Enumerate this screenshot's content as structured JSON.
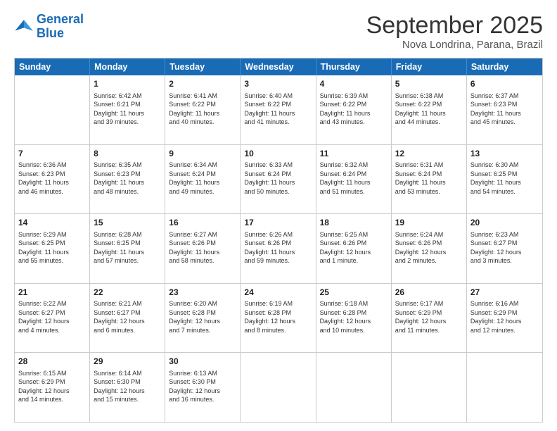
{
  "logo": {
    "line1": "General",
    "line2": "Blue"
  },
  "title": "September 2025",
  "subtitle": "Nova Londrina, Parana, Brazil",
  "days": [
    "Sunday",
    "Monday",
    "Tuesday",
    "Wednesday",
    "Thursday",
    "Friday",
    "Saturday"
  ],
  "weeks": [
    [
      {
        "day": "",
        "info": ""
      },
      {
        "day": "1",
        "info": "Sunrise: 6:42 AM\nSunset: 6:21 PM\nDaylight: 11 hours\nand 39 minutes."
      },
      {
        "day": "2",
        "info": "Sunrise: 6:41 AM\nSunset: 6:22 PM\nDaylight: 11 hours\nand 40 minutes."
      },
      {
        "day": "3",
        "info": "Sunrise: 6:40 AM\nSunset: 6:22 PM\nDaylight: 11 hours\nand 41 minutes."
      },
      {
        "day": "4",
        "info": "Sunrise: 6:39 AM\nSunset: 6:22 PM\nDaylight: 11 hours\nand 43 minutes."
      },
      {
        "day": "5",
        "info": "Sunrise: 6:38 AM\nSunset: 6:22 PM\nDaylight: 11 hours\nand 44 minutes."
      },
      {
        "day": "6",
        "info": "Sunrise: 6:37 AM\nSunset: 6:23 PM\nDaylight: 11 hours\nand 45 minutes."
      }
    ],
    [
      {
        "day": "7",
        "info": "Sunrise: 6:36 AM\nSunset: 6:23 PM\nDaylight: 11 hours\nand 46 minutes."
      },
      {
        "day": "8",
        "info": "Sunrise: 6:35 AM\nSunset: 6:23 PM\nDaylight: 11 hours\nand 48 minutes."
      },
      {
        "day": "9",
        "info": "Sunrise: 6:34 AM\nSunset: 6:24 PM\nDaylight: 11 hours\nand 49 minutes."
      },
      {
        "day": "10",
        "info": "Sunrise: 6:33 AM\nSunset: 6:24 PM\nDaylight: 11 hours\nand 50 minutes."
      },
      {
        "day": "11",
        "info": "Sunrise: 6:32 AM\nSunset: 6:24 PM\nDaylight: 11 hours\nand 51 minutes."
      },
      {
        "day": "12",
        "info": "Sunrise: 6:31 AM\nSunset: 6:24 PM\nDaylight: 11 hours\nand 53 minutes."
      },
      {
        "day": "13",
        "info": "Sunrise: 6:30 AM\nSunset: 6:25 PM\nDaylight: 11 hours\nand 54 minutes."
      }
    ],
    [
      {
        "day": "14",
        "info": "Sunrise: 6:29 AM\nSunset: 6:25 PM\nDaylight: 11 hours\nand 55 minutes."
      },
      {
        "day": "15",
        "info": "Sunrise: 6:28 AM\nSunset: 6:25 PM\nDaylight: 11 hours\nand 57 minutes."
      },
      {
        "day": "16",
        "info": "Sunrise: 6:27 AM\nSunset: 6:26 PM\nDaylight: 11 hours\nand 58 minutes."
      },
      {
        "day": "17",
        "info": "Sunrise: 6:26 AM\nSunset: 6:26 PM\nDaylight: 11 hours\nand 59 minutes."
      },
      {
        "day": "18",
        "info": "Sunrise: 6:25 AM\nSunset: 6:26 PM\nDaylight: 12 hours\nand 1 minute."
      },
      {
        "day": "19",
        "info": "Sunrise: 6:24 AM\nSunset: 6:26 PM\nDaylight: 12 hours\nand 2 minutes."
      },
      {
        "day": "20",
        "info": "Sunrise: 6:23 AM\nSunset: 6:27 PM\nDaylight: 12 hours\nand 3 minutes."
      }
    ],
    [
      {
        "day": "21",
        "info": "Sunrise: 6:22 AM\nSunset: 6:27 PM\nDaylight: 12 hours\nand 4 minutes."
      },
      {
        "day": "22",
        "info": "Sunrise: 6:21 AM\nSunset: 6:27 PM\nDaylight: 12 hours\nand 6 minutes."
      },
      {
        "day": "23",
        "info": "Sunrise: 6:20 AM\nSunset: 6:28 PM\nDaylight: 12 hours\nand 7 minutes."
      },
      {
        "day": "24",
        "info": "Sunrise: 6:19 AM\nSunset: 6:28 PM\nDaylight: 12 hours\nand 8 minutes."
      },
      {
        "day": "25",
        "info": "Sunrise: 6:18 AM\nSunset: 6:28 PM\nDaylight: 12 hours\nand 10 minutes."
      },
      {
        "day": "26",
        "info": "Sunrise: 6:17 AM\nSunset: 6:29 PM\nDaylight: 12 hours\nand 11 minutes."
      },
      {
        "day": "27",
        "info": "Sunrise: 6:16 AM\nSunset: 6:29 PM\nDaylight: 12 hours\nand 12 minutes."
      }
    ],
    [
      {
        "day": "28",
        "info": "Sunrise: 6:15 AM\nSunset: 6:29 PM\nDaylight: 12 hours\nand 14 minutes."
      },
      {
        "day": "29",
        "info": "Sunrise: 6:14 AM\nSunset: 6:30 PM\nDaylight: 12 hours\nand 15 minutes."
      },
      {
        "day": "30",
        "info": "Sunrise: 6:13 AM\nSunset: 6:30 PM\nDaylight: 12 hours\nand 16 minutes."
      },
      {
        "day": "",
        "info": ""
      },
      {
        "day": "",
        "info": ""
      },
      {
        "day": "",
        "info": ""
      },
      {
        "day": "",
        "info": ""
      }
    ]
  ]
}
